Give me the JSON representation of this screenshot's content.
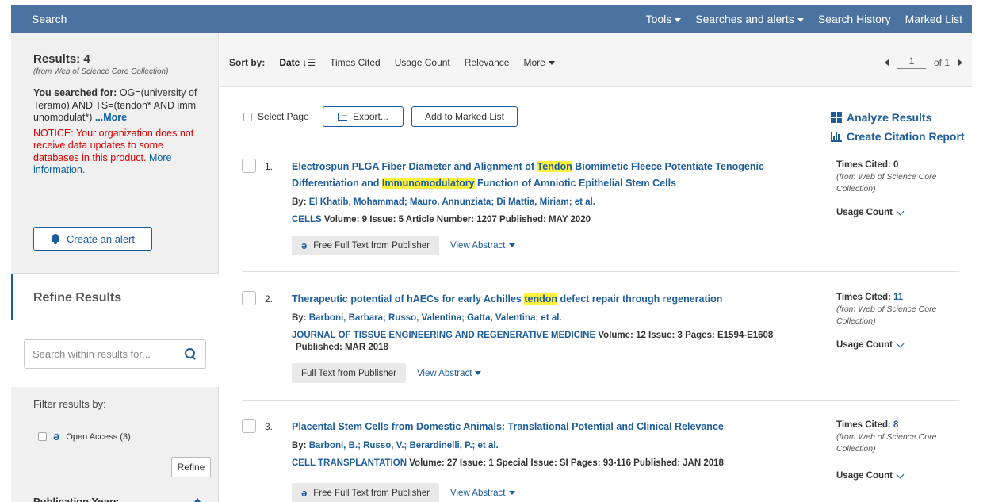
{
  "topbar": {
    "title": "Search",
    "nav": [
      "Tools",
      "Searches and alerts",
      "Search History",
      "Marked List"
    ]
  },
  "sidebar": {
    "results_label": "Results: 4",
    "results_source": "(from Web of Science Core Collection)",
    "searched_label": "You searched for:",
    "searched_query": " OG=(university of Teramo) AND TS=(tendon* AND imm unomodulat*) ",
    "searched_more": "...More",
    "notice": "NOTICE: Your organization does not receive data updates to some databases in this product. ",
    "notice_more": "More information.",
    "create_alert": "Create an alert",
    "refine_title": "Refine Results",
    "search_placeholder": "Search within results for...",
    "filter_label": "Filter results by:",
    "open_access": "Open Access (3)",
    "refine_button": "Refine",
    "publication_years": "Publication Years"
  },
  "sortbar": {
    "label": "Sort by:",
    "options": [
      "Date",
      "Times Cited",
      "Usage Count",
      "Relevance",
      "More"
    ],
    "page_current": "1",
    "page_total": "of 1"
  },
  "toolbar": {
    "select_page": "Select Page",
    "export": "Export...",
    "add_marked": "Add to Marked List",
    "analyze": "Analyze Results",
    "citation": "Create Citation Report"
  },
  "records": [
    {
      "num": "1.",
      "title_a": "Electrospun PLGA Fiber Diameter and Alignment of ",
      "hl1": "Tendon",
      "title_b": " Biomimetic Fleece Potentiate Tenogenic Differentiation and ",
      "hl2": "Immunomodulatory",
      "title_c": " Function of Amniotic Epithelial Stem Cells",
      "by": "By:",
      "authors": "El Khatib, Mohammad; Mauro, Annunziata; Di Mattia, Miriam; et al.",
      "journal": "CELLS",
      "details": " Volume: 9   Issue: 5    Article Number: 1207  Published:  MAY 2020",
      "published2": "",
      "fulltext": "Free Full Text from Publisher",
      "view_abstract": "View Abstract",
      "times_cited_label": "Times Cited: ",
      "times_cited": "0",
      "tc_source": "(from Web of Science Core Collection)",
      "usage": "Usage Count"
    },
    {
      "num": "2.",
      "title_a": "Therapeutic potential of hAECs for early Achilles ",
      "hl1": "tendon",
      "title_b": " defect repair through regeneration",
      "hl2": "",
      "title_c": "",
      "by": "By:",
      "authors": "Barboni, Barbara; Russo, Valentina; Gatta, Valentina; et al.",
      "journal": "JOURNAL OF TISSUE ENGINEERING AND REGENERATIVE MEDICINE",
      "details": "  Volume: 12   Issue: 3   Pages: E1594-E1608",
      "published2": "Published:  MAR 2018",
      "fulltext": "Full Text from Publisher",
      "view_abstract": "View Abstract",
      "times_cited_label": "Times Cited: ",
      "times_cited": "11",
      "tc_source": "(from Web of Science Core Collection)",
      "usage": "Usage Count"
    },
    {
      "num": "3.",
      "title_a": "Placental Stem Cells from Domestic Animals: Translational Potential and Clinical Relevance",
      "hl1": "",
      "title_b": "",
      "hl2": "",
      "title_c": "",
      "by": "By:",
      "authors": "Barboni, B.; Russo, V.; Berardinelli, P.; et al.",
      "journal": "CELL TRANSPLANTATION",
      "details": "  Volume: 27   Issue: 1   Special Issue: SI   Pages: 93-116   Published:  JAN 2018",
      "published2": "",
      "fulltext": "Free Full Text from Publisher",
      "view_abstract": "View Abstract",
      "times_cited_label": "Times Cited: ",
      "times_cited": "8",
      "tc_source": "(from Web of Science Core Collection)",
      "usage": "Usage Count"
    }
  ],
  "colors": {
    "topbar": "#4a73a1",
    "link": "#1e5d9b",
    "highlight": "#fff13d",
    "notice": "#dd0000"
  }
}
